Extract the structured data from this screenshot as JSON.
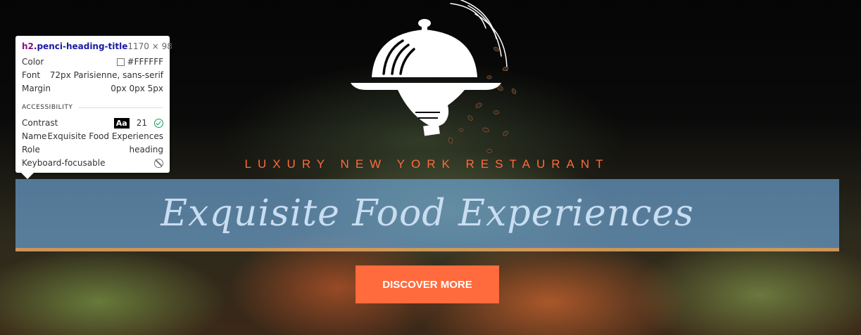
{
  "hero": {
    "tagline": "LUXURY NEW YORK RESTAURANT",
    "heading": "Exquisite Food Experiences",
    "cta_label": "DISCOVER MORE"
  },
  "tooltip": {
    "selector_tag": "h2",
    "selector_class": ".penci-heading-title",
    "dimensions": "1170 × 98",
    "rows": {
      "color_label": "Color",
      "color_value": "#FFFFFF",
      "font_label": "Font",
      "font_value": "72px Parisienne, sans-serif",
      "margin_label": "Margin",
      "margin_value": "0px 0px 5px"
    },
    "accessibility": {
      "section_title": "ACCESSIBILITY",
      "contrast_label": "Contrast",
      "contrast_badge": "Aa",
      "contrast_value": "21",
      "name_label": "Name",
      "name_value": "Exquisite Food Experiences",
      "role_label": "Role",
      "role_value": "heading",
      "keyboard_label": "Keyboard-focusable"
    }
  },
  "colors": {
    "accent": "#ff6b3d",
    "heading_highlight": "#6fa8dc",
    "margin_highlight": "#f6b26b",
    "swatch": "#FFFFFF"
  },
  "icons": [
    "restaurant-cloche-logo",
    "checkmark-icon",
    "not-allowed-icon"
  ]
}
